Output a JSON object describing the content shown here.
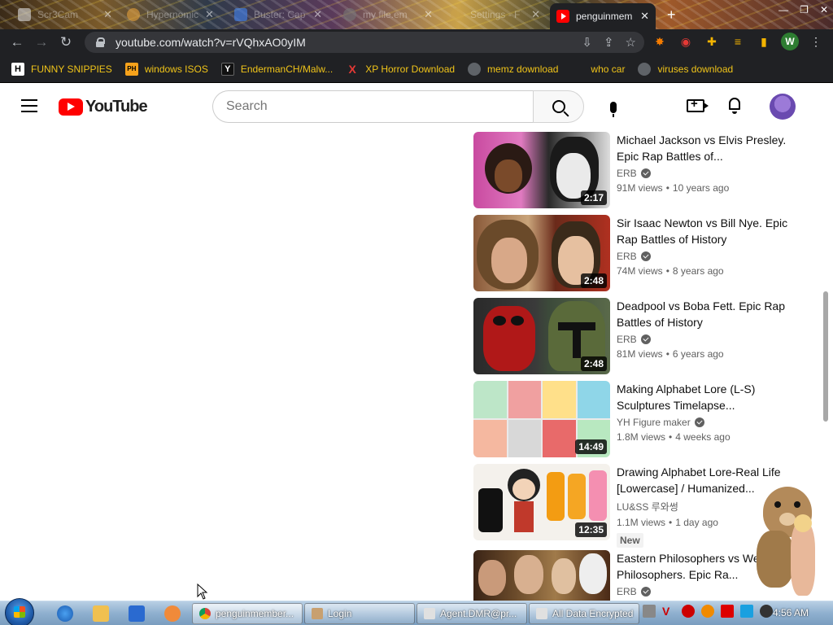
{
  "browser": {
    "tabs": [
      {
        "title": "Scr3Cam"
      },
      {
        "title": "Hypernomic"
      },
      {
        "title": "Buster: Cap"
      },
      {
        "title": "my file.em"
      },
      {
        "title": "Settings - F"
      },
      {
        "title": "penguinmem",
        "active": true
      }
    ],
    "url": "youtube.com/watch?v=rVQhxAO0yIM",
    "bookmarks": [
      {
        "label": "FUNNY SNIPPIES",
        "icon": "H"
      },
      {
        "label": "windows ISOS",
        "icon": "PH"
      },
      {
        "label": "EndermanCH/Malw...",
        "icon": "Y"
      },
      {
        "label": "XP Horror Download",
        "icon": "X"
      },
      {
        "label": "memz download",
        "icon": "globe"
      },
      {
        "label": "who car",
        "icon": ""
      },
      {
        "label": "viruses download",
        "icon": "globe"
      }
    ],
    "profile_initial": "W"
  },
  "youtube": {
    "logo_text": "YouTube",
    "search_placeholder": "Search",
    "videos": [
      {
        "title": "Michael Jackson vs Elvis Presley. Epic Rap Battles of...",
        "channel": "ERB",
        "verified": true,
        "views": "91M views",
        "age": "10 years ago",
        "duration": "2:17",
        "new": false
      },
      {
        "title": "Sir Isaac Newton vs Bill Nye. Epic Rap Battles of History",
        "channel": "ERB",
        "verified": true,
        "views": "74M views",
        "age": "8 years ago",
        "duration": "2:48",
        "new": false
      },
      {
        "title": "Deadpool vs Boba Fett. Epic Rap Battles of History",
        "channel": "ERB",
        "verified": true,
        "views": "81M views",
        "age": "6 years ago",
        "duration": "2:48",
        "new": false
      },
      {
        "title": "Making Alphabet Lore (L-S) Sculptures Timelapse...",
        "channel": "YH Figure maker",
        "verified": true,
        "views": "1.8M views",
        "age": "4 weeks ago",
        "duration": "14:49",
        "new": false
      },
      {
        "title": "Drawing Alphabet Lore-Real Life [Lowercase] / Humanized...",
        "channel": "LU&SS 루와썽",
        "verified": false,
        "views": "1.1M views",
        "age": "1 day ago",
        "duration": "12:35",
        "new": true,
        "new_label": "New"
      },
      {
        "title": "Eastern Philosophers vs Western Philosophers. Epic Ra...",
        "channel": "ERB",
        "verified": true,
        "views": "",
        "age": "",
        "duration": "",
        "new": false
      }
    ]
  },
  "taskbar": {
    "buttons": [
      {
        "label": "penguinmember..."
      },
      {
        "label": "Login"
      },
      {
        "label": "Agent.DMR@pr..."
      },
      {
        "label": "All Data Encrypted"
      }
    ],
    "clock": "4:56 AM"
  },
  "colors": {
    "yt_red": "#ff0000",
    "chrome_dark": "#202124",
    "bookmark_text": "#f0c419"
  }
}
